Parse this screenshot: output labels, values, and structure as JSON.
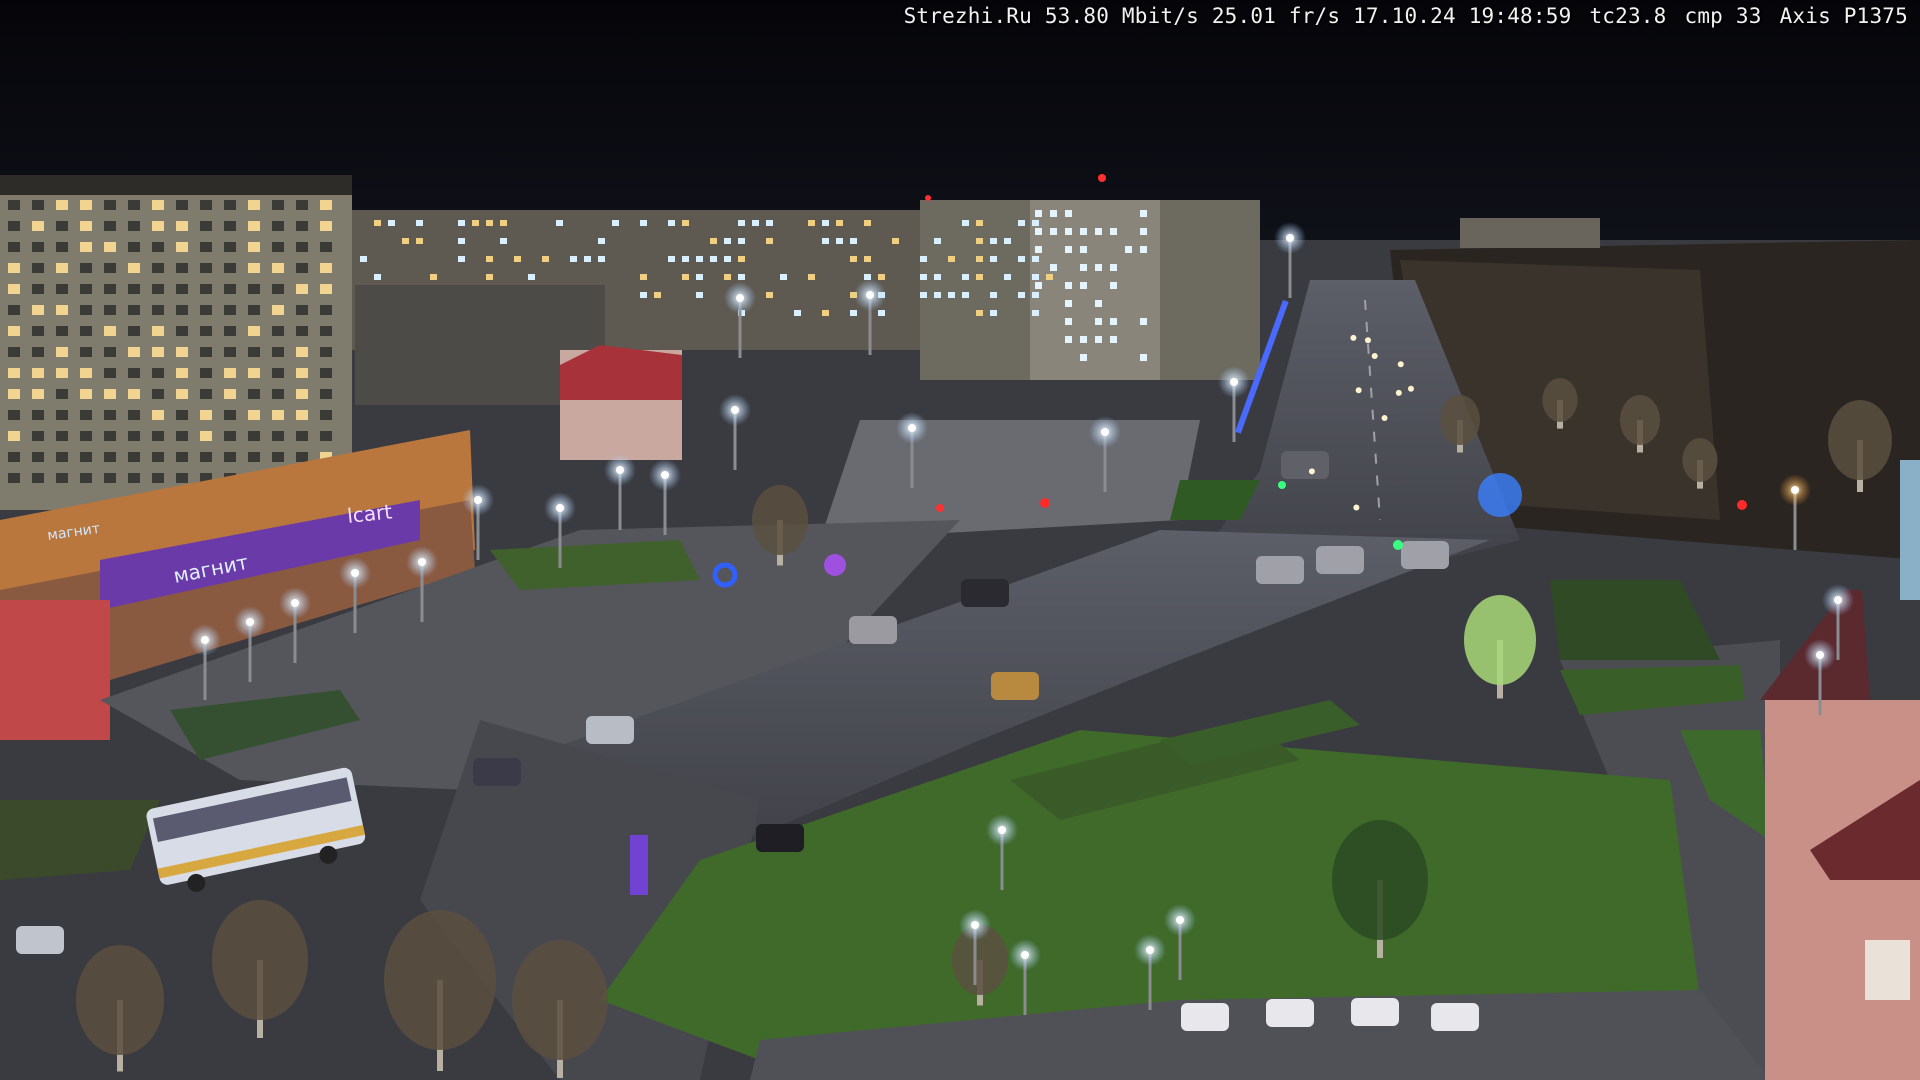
{
  "overlay": {
    "site": "Strezhi.Ru",
    "bitrate": "53.80 Mbit/s",
    "framerate": "25.01 fr/s",
    "date": "17.10.24",
    "time": "19:48:59",
    "tc": "tc23.8",
    "cmp": "cmp 33",
    "camera": "Axis P1375"
  },
  "signs": {
    "store_main": "магнит",
    "store_left": "магнит",
    "store_right": "lcart"
  },
  "colors": {
    "sky": "#06060c",
    "asphalt": "#4a4a52",
    "grass": "#3f6a2a",
    "building": "#8a8676",
    "lamp": "#e8f4ff",
    "store_facade": "#c0783a",
    "store_sign": "#6a3aa8"
  }
}
